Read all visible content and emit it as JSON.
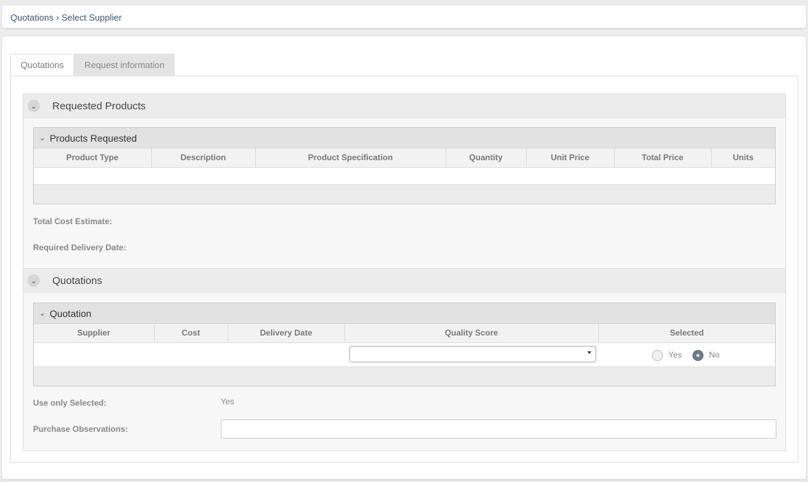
{
  "breadcrumb": {
    "root": "Quotations",
    "separator": "›",
    "current": "Select Supplier"
  },
  "tabs": [
    {
      "label": "Quotations",
      "active": true
    },
    {
      "label": "Request information",
      "active": false
    }
  ],
  "requested_products": {
    "title": "Requested Products",
    "grid_title": "Products Requested",
    "columns": [
      "Product Type",
      "Description",
      "Product Specification",
      "Quantity",
      "Unit Price",
      "Total Price",
      "Units"
    ],
    "total_cost_label": "Total Cost Estimate:",
    "delivery_date_label": "Required Delivery Date:"
  },
  "quotations": {
    "title": "Quotations",
    "grid_title": "Quotation",
    "columns": [
      "Supplier",
      "Cost",
      "Delivery Date",
      "Quality Score",
      "Selected"
    ],
    "quality_score_value": "",
    "selected_options": {
      "yes": "Yes",
      "no": "No",
      "value": "No"
    },
    "use_only_selected_label": "Use only Selected:",
    "use_only_selected_value": "Yes",
    "purchase_observations_label": "Purchase Observations:",
    "purchase_observations_value": ""
  }
}
